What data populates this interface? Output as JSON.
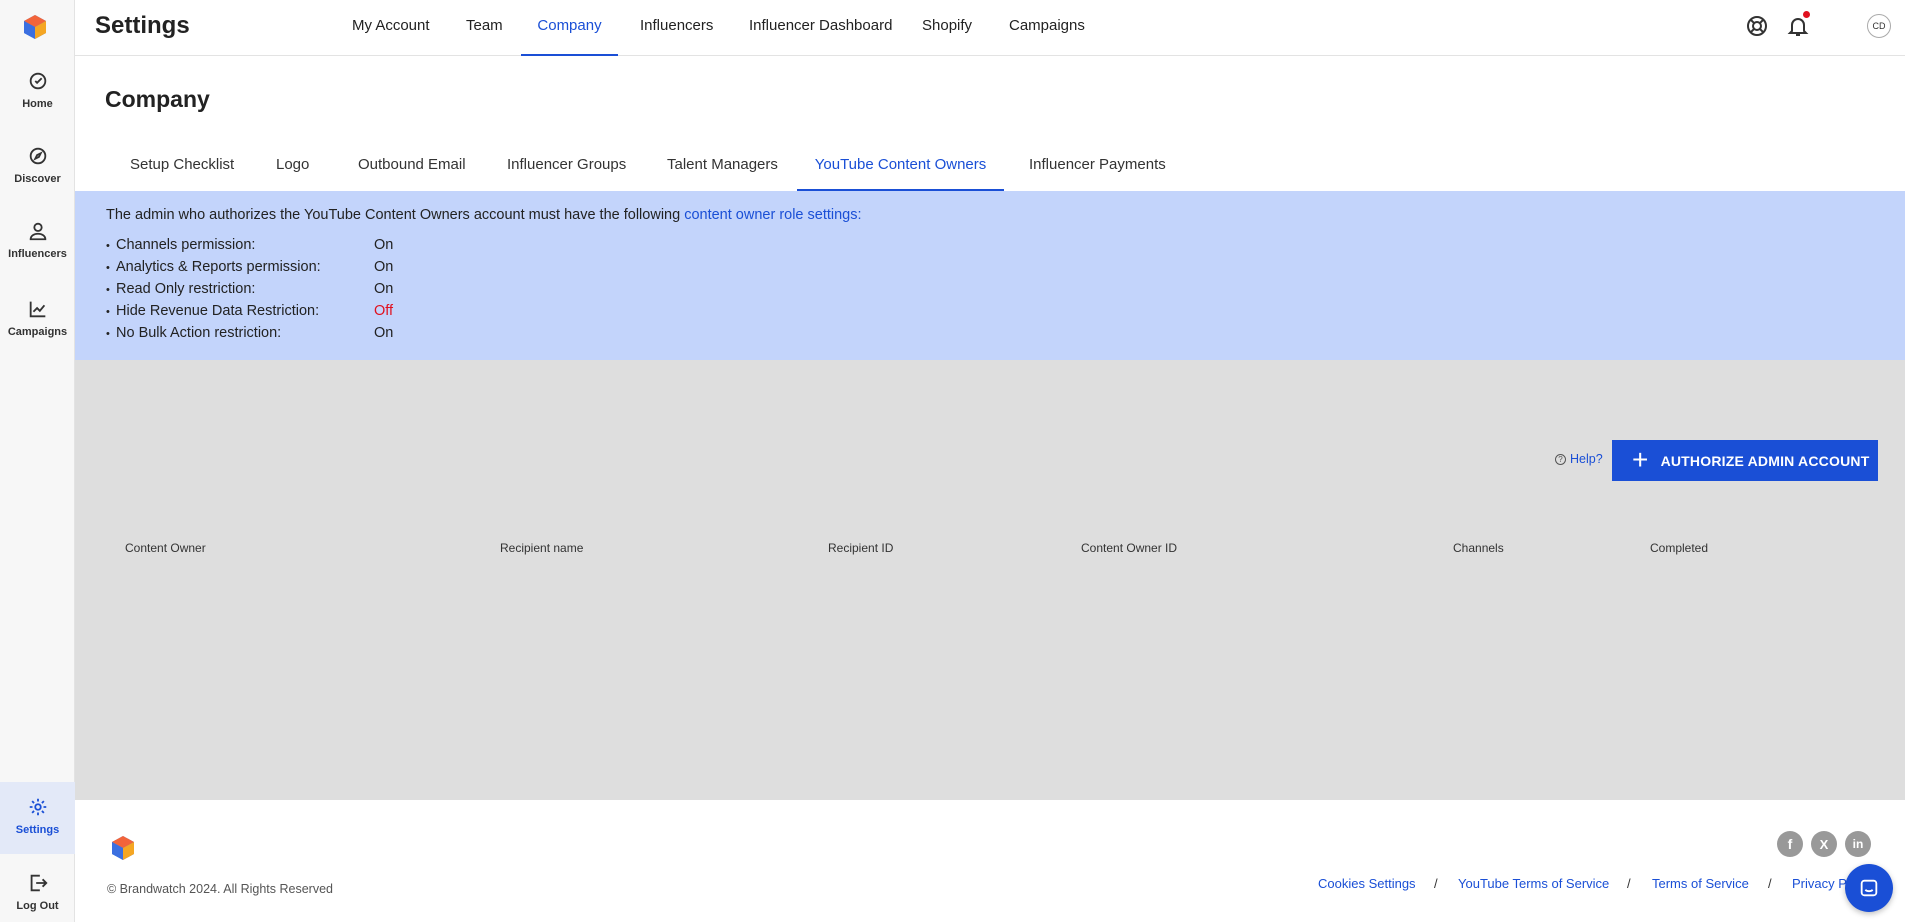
{
  "app": {
    "title": "Settings"
  },
  "sidebar": {
    "items": [
      {
        "label": "Home",
        "icon": "home-icon"
      },
      {
        "label": "Discover",
        "icon": "compass-icon"
      },
      {
        "label": "Influencers",
        "icon": "user-icon"
      },
      {
        "label": "Campaigns",
        "icon": "campaign-icon"
      }
    ],
    "bottom": [
      {
        "label": "Settings",
        "icon": "gear-icon",
        "active": true
      },
      {
        "label": "Log Out",
        "icon": "logout-icon"
      }
    ]
  },
  "header": {
    "tabs": [
      {
        "label": "My Account"
      },
      {
        "label": "Team"
      },
      {
        "label": "Company",
        "active": true
      },
      {
        "label": "Influencers"
      },
      {
        "label": "Influencer Dashboard"
      },
      {
        "label": "Shopify"
      },
      {
        "label": "Campaigns"
      }
    ],
    "icons": [
      "help-lifebuoy-icon",
      "bell-icon"
    ],
    "avatar_initials": "CD"
  },
  "page": {
    "title": "Company",
    "subtabs": [
      {
        "label": "Setup Checklist"
      },
      {
        "label": "Logo"
      },
      {
        "label": "Outbound Email"
      },
      {
        "label": "Influencer Groups"
      },
      {
        "label": "Talent Managers"
      },
      {
        "label": "YouTube Content Owners",
        "active": true
      },
      {
        "label": "Influencer Payments"
      }
    ]
  },
  "banner": {
    "text": "The admin who authorizes the YouTube Content Owners account must have the following ",
    "link": "content owner role settings:",
    "permissions": [
      {
        "name": "Channels permission:",
        "value": "On"
      },
      {
        "name": "Analytics & Reports permission:",
        "value": "On"
      },
      {
        "name": "Read Only restriction:",
        "value": "On"
      },
      {
        "name": "Hide Revenue Data Restriction:",
        "value": "Off"
      },
      {
        "name": "No Bulk Action restriction:",
        "value": "On"
      }
    ]
  },
  "content": {
    "help_label": "Help?",
    "authorize_button": "AUTHORIZE ADMIN ACCOUNT",
    "table_headers": [
      "Content Owner",
      "Recipient name",
      "Recipient ID",
      "Content Owner ID",
      "Channels",
      "Completed"
    ]
  },
  "footer": {
    "copyright": "© Brandwatch 2024. All Rights Reserved",
    "links": [
      "Cookies Settings",
      "YouTube Terms of Service",
      "Terms of Service",
      "Privacy P"
    ],
    "social": [
      "facebook-icon",
      "x-icon",
      "linkedin-icon"
    ]
  },
  "colors": {
    "accent": "#1a4fd6",
    "banner": "#c3d4fb",
    "off": "#e0111f",
    "content_bg": "#dedede"
  }
}
